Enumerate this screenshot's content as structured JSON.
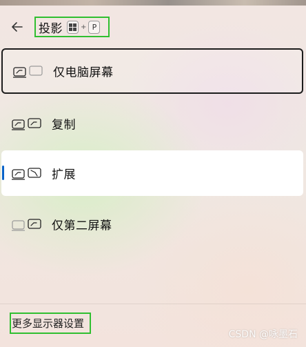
{
  "header": {
    "title": "投影",
    "shortcut": {
      "key1": "win-logo",
      "plus": "+",
      "key2": "P"
    }
  },
  "options": [
    {
      "label": "仅电脑屏幕",
      "icon": "pc-screen-only-icon",
      "state": "focused"
    },
    {
      "label": "复制",
      "icon": "duplicate-icon",
      "state": "default"
    },
    {
      "label": "扩展",
      "icon": "extend-icon",
      "state": "selected"
    },
    {
      "label": "仅第二屏幕",
      "icon": "second-screen-only-icon",
      "state": "default"
    }
  ],
  "footer": {
    "link_label": "更多显示器设置"
  },
  "watermark": "CSDN @咏墨石",
  "colors": {
    "highlight_border": "#2fbf2f",
    "selected_indicator": "#0a63c8",
    "focus_ring": "#1c1c1c"
  }
}
